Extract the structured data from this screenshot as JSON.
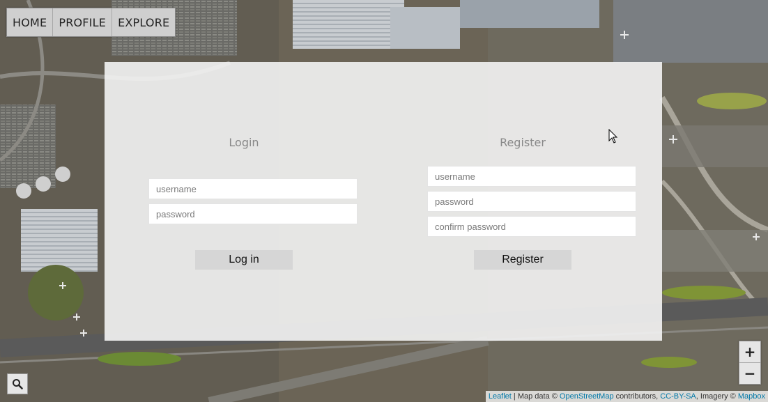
{
  "nav": {
    "items": [
      {
        "label": "HOME"
      },
      {
        "label": "PROFILE"
      },
      {
        "label": "EXPLORE"
      }
    ]
  },
  "login": {
    "title": "Login",
    "username_placeholder": "username",
    "password_placeholder": "password",
    "button_label": "Log in"
  },
  "register": {
    "title": "Register",
    "username_placeholder": "username",
    "password_placeholder": "password",
    "confirm_placeholder": "confirm password",
    "button_label": "Register"
  },
  "zoom": {
    "in_label": "+",
    "out_label": "−"
  },
  "attribution": {
    "leaflet": "Leaflet",
    "sep1": " | Map data © ",
    "osm": "OpenStreetMap",
    "contributors": " contributors, ",
    "license": "CC-BY-SA",
    "imagery": ", Imagery © ",
    "mapbox": "Mapbox"
  },
  "icons": {
    "search": "search-icon",
    "cursor": "mouse-cursor-icon"
  },
  "colors": {
    "panel_bg": "#f4f4f4",
    "nav_bg": "#cfcfcf",
    "button_bg": "#d6d6d6",
    "link": "#0078a8"
  }
}
